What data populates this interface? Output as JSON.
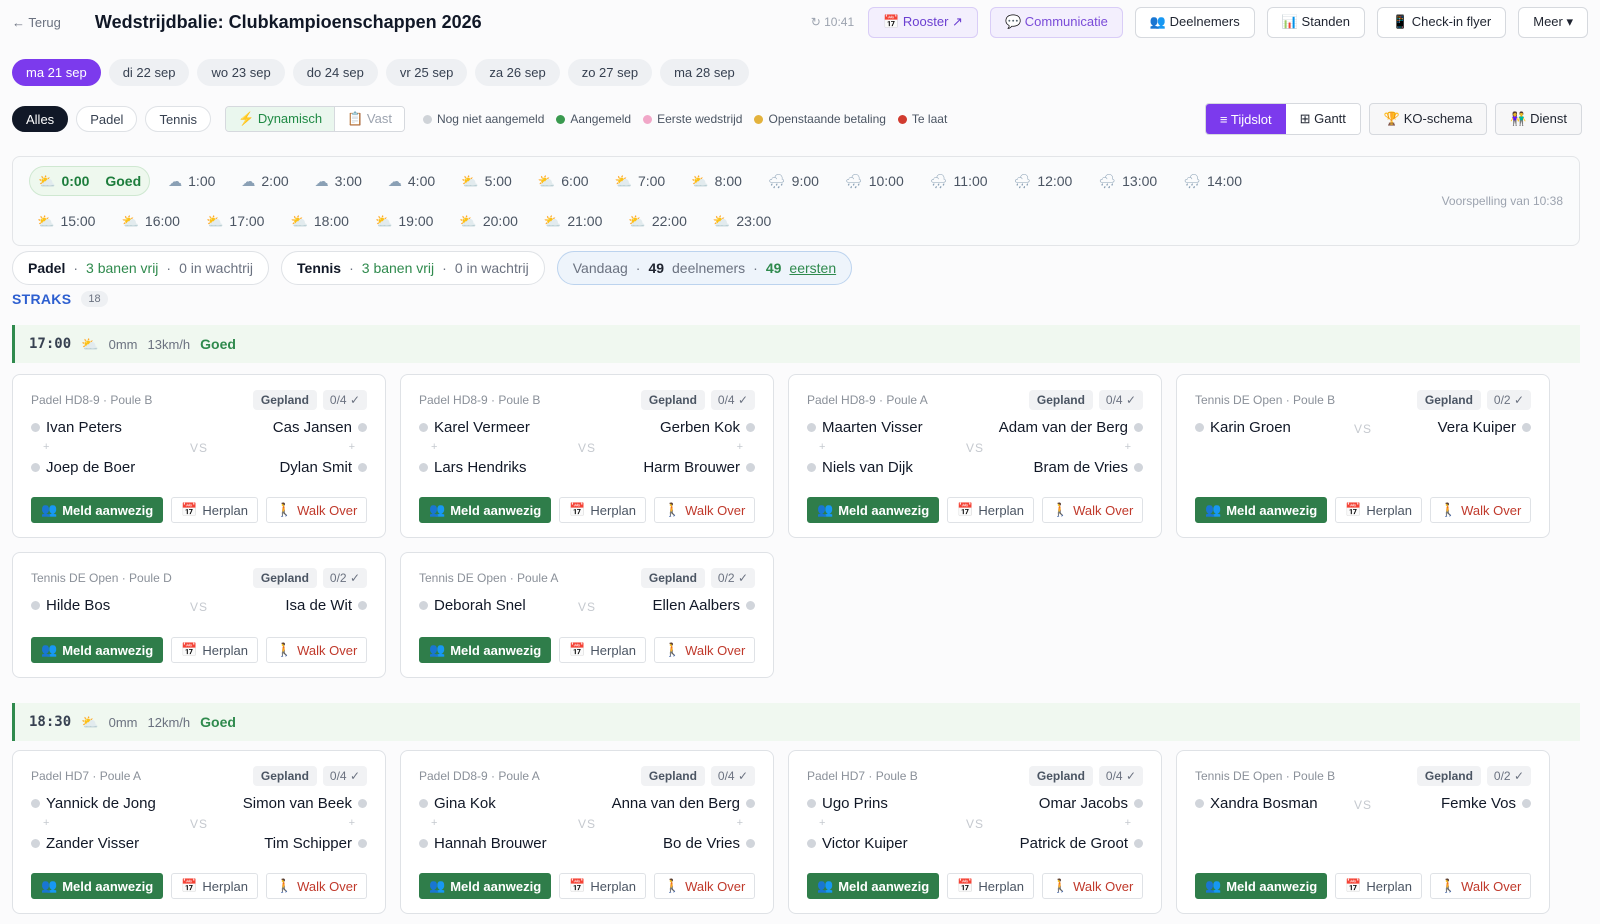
{
  "header": {
    "back_label": "← Terug",
    "title": "Wedstrijdbalie: Clubkampioenschappen 2026",
    "clock": "↻ 10:41",
    "buttons": {
      "rooster": "📅 Rooster ↗",
      "communicatie": "💬 Communicatie",
      "deelnemers": "👥 Deelnemers",
      "standen": "📊 Standen",
      "checkin": "📱 Check-in flyer",
      "meer": "Meer ▾"
    }
  },
  "days": [
    "ma 21 sep",
    "di 22 sep",
    "wo 23 sep",
    "do 24 sep",
    "vr 25 sep",
    "za 26 sep",
    "zo 27 sep",
    "ma 28 sep"
  ],
  "filters": {
    "sports": [
      "Alles",
      "Padel",
      "Tennis"
    ],
    "mode_dynamic": "⚡ Dynamisch",
    "mode_fixed": "📋 Vast",
    "legend": [
      {
        "label": "Nog niet aangemeld",
        "color": "#cfd3d8"
      },
      {
        "label": "Aangemeld",
        "color": "#3a9a4f"
      },
      {
        "label": "Eerste wedstrijd",
        "color": "#f1a7c8"
      },
      {
        "label": "Openstaande betaling",
        "color": "#e3b23c"
      },
      {
        "label": "Te laat",
        "color": "#d13b2f"
      }
    ],
    "views": {
      "tijdslot": "≡ Tijdslot",
      "gantt": "⊞ Gantt",
      "ko": "🏆 KO-schema",
      "dienst": "👫 Dienst"
    }
  },
  "weather": {
    "selected_status": "Goed",
    "hours": [
      "0:00",
      "1:00",
      "2:00",
      "3:00",
      "4:00",
      "5:00",
      "6:00",
      "7:00",
      "8:00",
      "9:00",
      "10:00",
      "11:00",
      "12:00",
      "13:00",
      "14:00",
      "15:00",
      "16:00",
      "17:00",
      "18:00",
      "19:00",
      "20:00",
      "21:00",
      "22:00",
      "23:00"
    ],
    "forecast": "Voorspelling van 10:38"
  },
  "summary": {
    "padel": {
      "name": "Padel",
      "free": "3 banen vrij",
      "queue": "0 in wachtrij"
    },
    "tennis": {
      "name": "Tennis",
      "free": "3 banen vrij",
      "queue": "0 in wachtrij"
    },
    "today": {
      "label": "Vandaag",
      "participants": "49",
      "participants_label": "deelnemers",
      "firsts": "49",
      "firsts_label": "eersten"
    }
  },
  "straks": {
    "label": "STRAKS",
    "count": "18"
  },
  "slots": [
    {
      "time": "17:00",
      "rain": "0mm",
      "wind": "13km/h",
      "status": "Goed"
    },
    {
      "time": "18:30",
      "rain": "0mm",
      "wind": "12km/h",
      "status": "Goed"
    }
  ],
  "labels": {
    "vs": "VS",
    "plus": "+",
    "checkin": "Meld aanwezig",
    "replan": "Herplan",
    "walkover": "Walk Over"
  },
  "matches": [
    {
      "cat": "Padel HD8-9 · Poule B",
      "status": "Gepland",
      "count": "0/4 ✓",
      "a1": "Ivan Peters",
      "a2": "Joep de Boer",
      "b1": "Cas Jansen",
      "b2": "Dylan Smit"
    },
    {
      "cat": "Padel HD8-9 · Poule B",
      "status": "Gepland",
      "count": "0/4 ✓",
      "a1": "Karel Vermeer",
      "a2": "Lars Hendriks",
      "b1": "Gerben Kok",
      "b2": "Harm Brouwer"
    },
    {
      "cat": "Padel HD8-9 · Poule A",
      "status": "Gepland",
      "count": "0/4 ✓",
      "a1": "Maarten Visser",
      "a2": "Niels van Dijk",
      "b1": "Adam van der Berg",
      "b2": "Bram de Vries"
    },
    {
      "cat": "Tennis DE Open · Poule B",
      "status": "Gepland",
      "count": "0/2 ✓",
      "a1": "Karin Groen",
      "b1": "Vera Kuiper"
    },
    {
      "cat": "Tennis DE Open · Poule D",
      "status": "Gepland",
      "count": "0/2 ✓",
      "a1": "Hilde Bos",
      "b1": "Isa de Wit"
    },
    {
      "cat": "Tennis DE Open · Poule A",
      "status": "Gepland",
      "count": "0/2 ✓",
      "a1": "Deborah Snel",
      "b1": "Ellen Aalbers"
    },
    {
      "cat": "Padel HD7 · Poule A",
      "status": "Gepland",
      "count": "0/4 ✓",
      "a1": "Yannick de Jong",
      "a2": "Zander Visser",
      "b1": "Simon van Beek",
      "b2": "Tim Schipper"
    },
    {
      "cat": "Padel DD8-9 · Poule A",
      "status": "Gepland",
      "count": "0/4 ✓",
      "a1": "Gina Kok",
      "a2": "Hannah Brouwer",
      "b1": "Anna van den Berg",
      "b2": "Bo de Vries"
    },
    {
      "cat": "Padel HD7 · Poule B",
      "status": "Gepland",
      "count": "0/4 ✓",
      "a1": "Ugo Prins",
      "a2": "Victor Kuiper",
      "b1": "Omar Jacobs",
      "b2": "Patrick de Groot"
    },
    {
      "cat": "Tennis DE Open · Poule B",
      "status": "Gepland",
      "count": "0/2 ✓",
      "a1": "Xandra Bosman",
      "b1": "Femke Vos"
    }
  ]
}
